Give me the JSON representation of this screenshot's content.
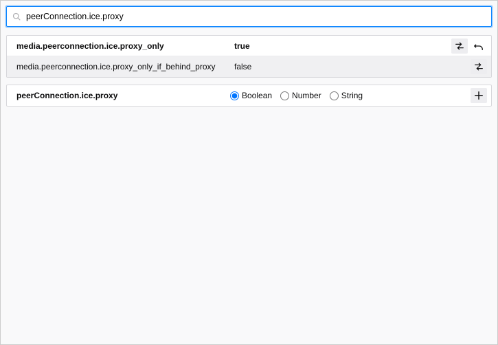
{
  "search": {
    "value": "peerConnection.ice.proxy",
    "placeholder": ""
  },
  "prefs": [
    {
      "name": "media.peerconnection.ice.proxy_only",
      "value": "true",
      "modified": true,
      "toggle": true,
      "reset": true
    },
    {
      "name": "media.peerconnection.ice.proxy_only_if_behind_proxy",
      "value": "false",
      "modified": false,
      "toggle": true,
      "reset": false
    }
  ],
  "newPref": {
    "name": "peerConnection.ice.proxy",
    "types": [
      "Boolean",
      "Number",
      "String"
    ],
    "selected": "Boolean"
  }
}
